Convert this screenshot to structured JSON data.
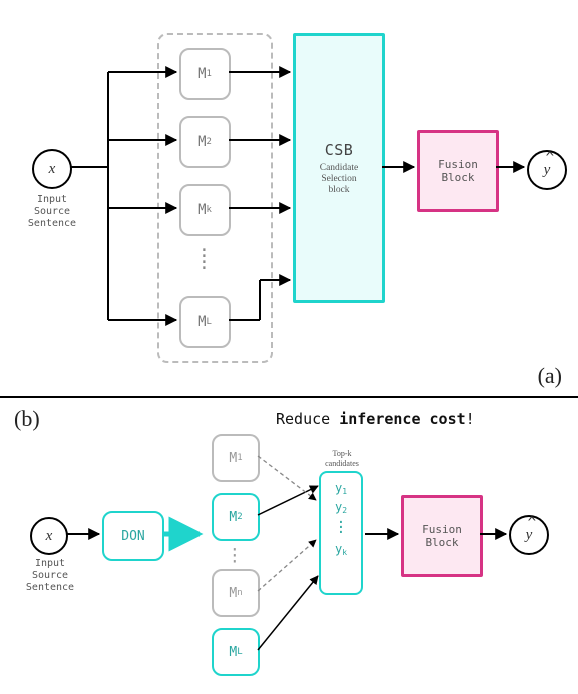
{
  "a": {
    "input_x": "x",
    "input_label": "Input Source\nSentence",
    "m1": "M",
    "m1_sub": "1",
    "m2": "M",
    "m2_sub": "2",
    "mk": "M",
    "mk_sub": "k",
    "ml": "M",
    "ml_sub": "L",
    "csb_title": "CSB",
    "csb_sub": "Candidate\nSelection\nblock",
    "fusion": "Fusion\nBlock",
    "out": "y",
    "label": "(a)"
  },
  "b": {
    "label": "(b)",
    "tagline_prefix": "Reduce ",
    "tagline_bold": "inference cost",
    "tagline_suffix": "!",
    "input_x": "x",
    "input_label": "Input Source\nSentence",
    "don": "DON",
    "m1": "M",
    "m1_sub": "1",
    "m2": "M",
    "m2_sub": "2",
    "mn": "M",
    "mn_sub": "n",
    "ml": "M",
    "ml_sub": "L",
    "cand_label": "Top-k\ncandidates",
    "y1": "y",
    "y1_sub": "1",
    "y2": "y",
    "y2_sub": "2",
    "yk": "y",
    "yk_sub": "k",
    "fusion": "Fusion\nBlock",
    "out": "y"
  }
}
